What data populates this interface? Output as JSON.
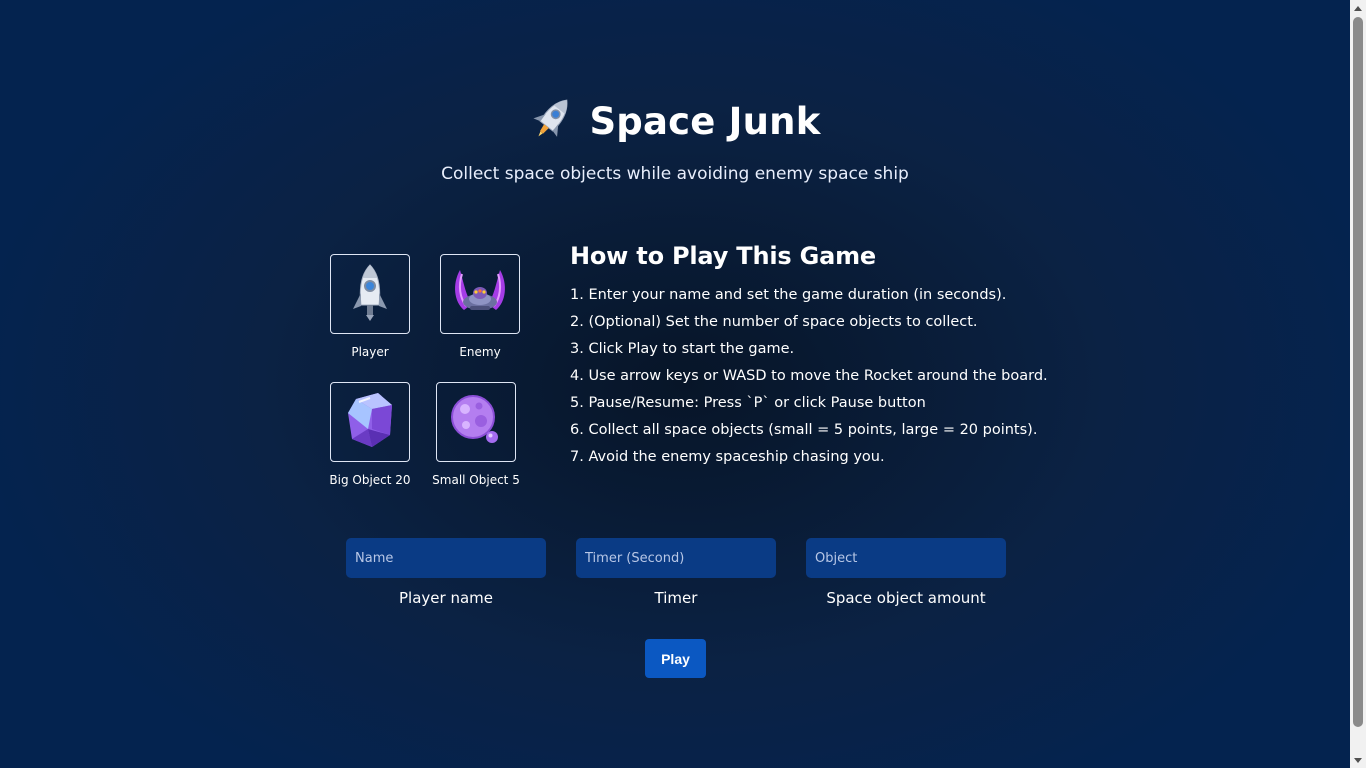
{
  "header": {
    "title": "Space Junk",
    "subtitle": "Collect space objects while avoiding enemy space ship",
    "logo_icon": "rocket-icon"
  },
  "tiles": [
    {
      "label": "Player",
      "icon": "rocket-icon"
    },
    {
      "label": "Enemy",
      "icon": "enemy-spaceship-icon"
    },
    {
      "label": "Big Object 20",
      "icon": "big-crystal-icon"
    },
    {
      "label": "Small Object 5",
      "icon": "small-asteroid-icon"
    }
  ],
  "howto": {
    "title": "How to Play This Game",
    "steps": [
      "1. Enter your name and set the game duration (in seconds).",
      "2. (Optional) Set the number of space objects to collect.",
      "3. Click Play to start the game.",
      "4. Use arrow keys or WASD to move the Rocket around the board.",
      "5. Pause/Resume: Press `P` or click Pause button",
      "6. Collect all space objects (small = 5 points, large = 20 points).",
      "7. Avoid the enemy spaceship chasing you."
    ]
  },
  "form": {
    "name": {
      "placeholder": "Name",
      "value": "",
      "label": "Player name"
    },
    "timer": {
      "placeholder": "Timer (Second)",
      "value": "",
      "label": "Timer"
    },
    "objects": {
      "placeholder": "Object",
      "value": "",
      "label": "Space object amount"
    },
    "play_label": "Play"
  },
  "colors": {
    "background": "#0b2244",
    "input_bg": "#0a3b85",
    "button_bg": "#0b58c2"
  }
}
